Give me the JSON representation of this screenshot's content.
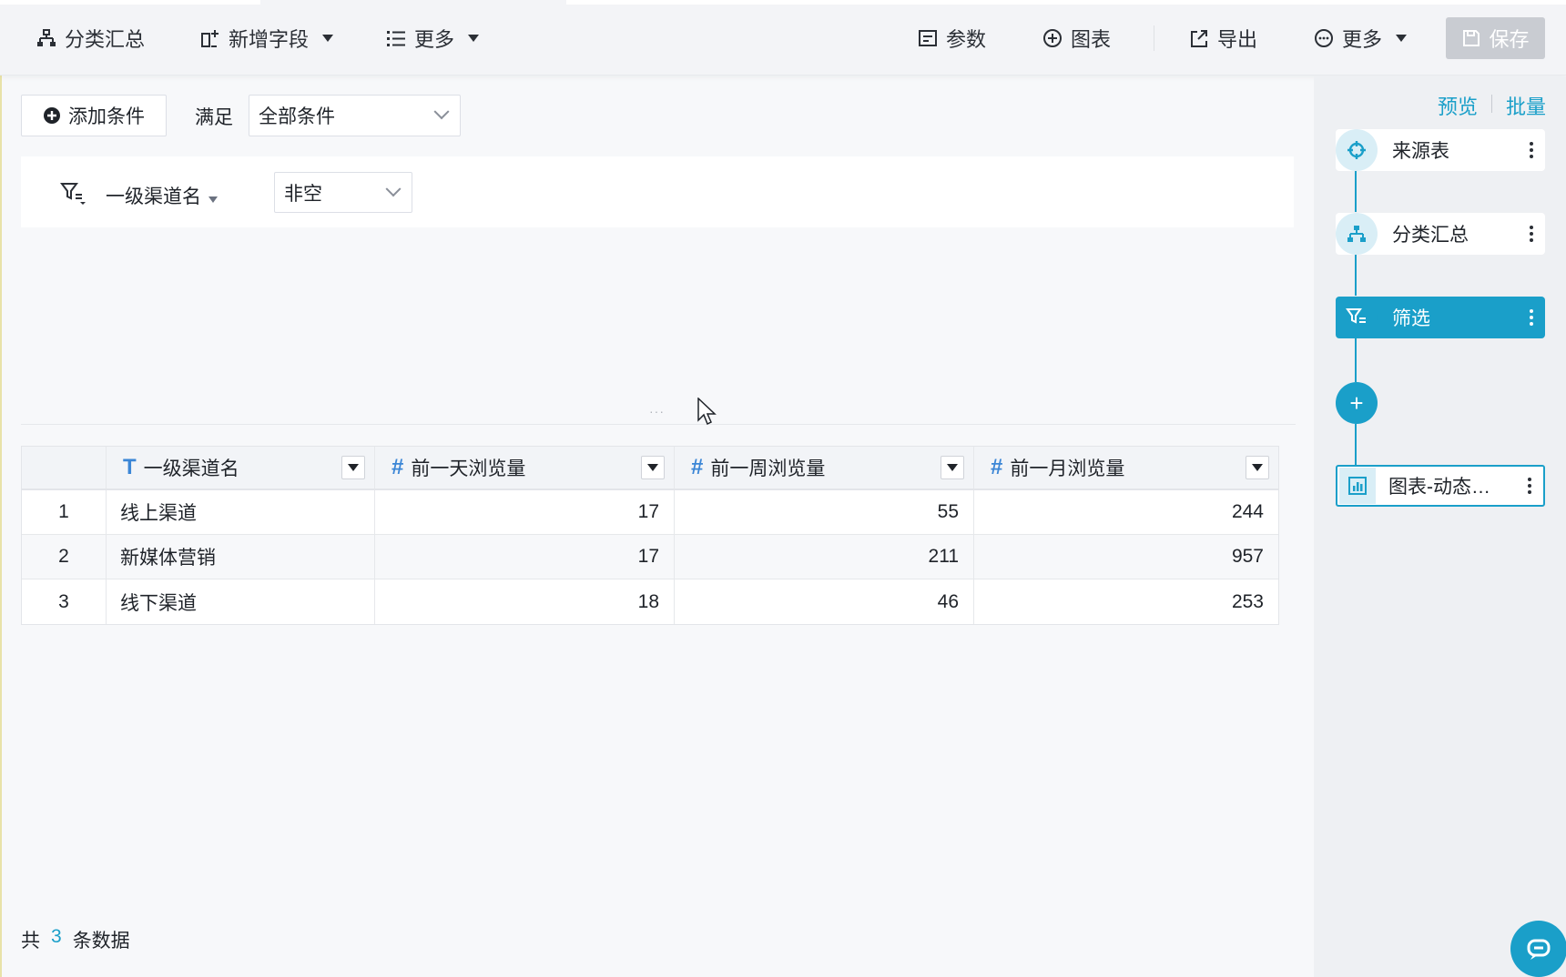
{
  "toolbar": {
    "group_summary": "分类汇总",
    "add_field": "新增字段",
    "more_left": "更多",
    "params": "参数",
    "chart": "图表",
    "export": "导出",
    "more_right": "更多",
    "save": "保存"
  },
  "condition_bar": {
    "add_condition": "添加条件",
    "satisfy_label": "满足",
    "satisfy_value": "全部条件"
  },
  "filter": {
    "field_name": "一级渠道名",
    "operator": "非空"
  },
  "table": {
    "columns": [
      {
        "type_icon": "T",
        "title": "一级渠道名"
      },
      {
        "type_icon": "#",
        "title": "前一天浏览量"
      },
      {
        "type_icon": "#",
        "title": "前一周浏览量"
      },
      {
        "type_icon": "#",
        "title": "前一月浏览量"
      }
    ],
    "rows": [
      {
        "index": "1",
        "channel": "线上渠道",
        "day": "17",
        "week": "55",
        "month": "244"
      },
      {
        "index": "2",
        "channel": "新媒体营销",
        "day": "17",
        "week": "211",
        "month": "957"
      },
      {
        "index": "3",
        "channel": "线下渠道",
        "day": "18",
        "week": "46",
        "month": "253"
      }
    ]
  },
  "footer": {
    "prefix": "共",
    "count": "3",
    "suffix": "条数据"
  },
  "steps_panel": {
    "preview_link": "预览",
    "batch_link": "批量",
    "steps": [
      {
        "label": "来源表",
        "icon": "source-icon",
        "active": false
      },
      {
        "label": "分类汇总",
        "icon": "group-summary-icon",
        "active": false
      },
      {
        "label": "筛选",
        "icon": "filter-icon",
        "active": true
      }
    ],
    "add_step": "+",
    "chart_step": "图表-动态…"
  },
  "colors": {
    "accent": "#1a9fc9",
    "save_disabled": "#c9ccd2",
    "type_icon": "#3b86d6"
  }
}
